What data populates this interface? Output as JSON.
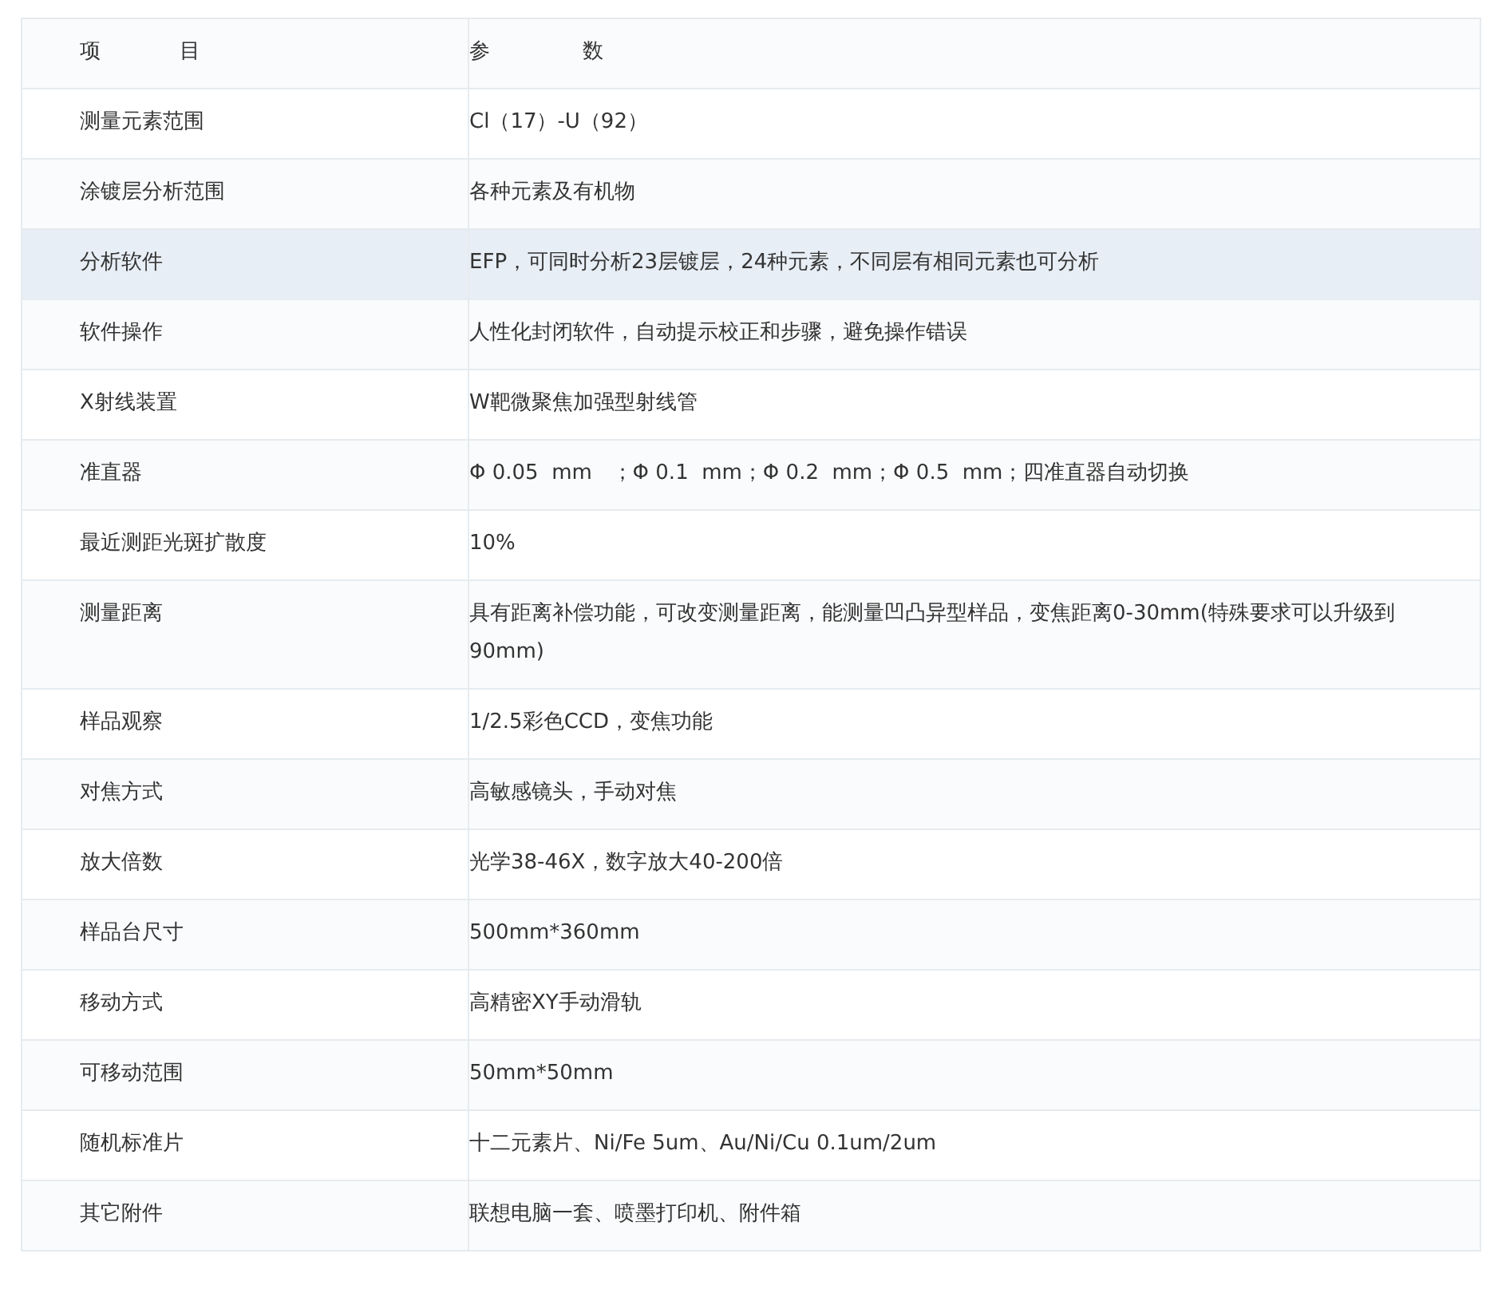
{
  "table": {
    "columns": [
      "项            目",
      "参              数"
    ],
    "rows": [
      {
        "item": "测量元素范围",
        "value": "Cl（17）-U（92）",
        "selected": false
      },
      {
        "item": "涂镀层分析范围",
        "value": "各种元素及有机物",
        "selected": false
      },
      {
        "item": "分析软件",
        "value": "EFP，可同时分析23层镀层，24种元素，不同层有相同元素也可分析",
        "selected": true
      },
      {
        "item": "软件操作",
        "value": "人性化封闭软件，自动提示校正和步骤，避免操作错误",
        "selected": false
      },
      {
        "item": "X射线装置",
        "value": "W靶微聚焦加强型射线管",
        "selected": false
      },
      {
        "item": "准直器",
        "value": "Φ 0.05  mm   ；Φ 0.1  mm；Φ 0.2  mm；Φ 0.5  mm；四准直器自动切换",
        "selected": false
      },
      {
        "item": "最近测距光斑扩散度",
        "value": "10%",
        "selected": false
      },
      {
        "item": "测量距离",
        "value": "具有距离补偿功能，可改变测量距离，能测量凹凸异型样品，变焦距离0-30mm(特殊要求可以升级到90mm)",
        "selected": false
      },
      {
        "item": "样品观察",
        "value": "1/2.5彩色CCD，变焦功能",
        "selected": false
      },
      {
        "item": "对焦方式",
        "value": "高敏感镜头，手动对焦",
        "selected": false
      },
      {
        "item": "放大倍数",
        "value": "光学38-46X，数字放大40-200倍",
        "selected": false
      },
      {
        "item": "样品台尺寸",
        "value": "500mm*360mm",
        "selected": false
      },
      {
        "item": "移动方式",
        "value": "高精密XY手动滑轨",
        "selected": false
      },
      {
        "item": "可移动范围",
        "value": "50mm*50mm",
        "selected": false
      },
      {
        "item": "随机标准片",
        "value": "十二元素片、Ni/Fe 5um、Au/Ni/Cu 0.1um/2um",
        "selected": false
      },
      {
        "item": "其它附件",
        "value": "联想电脑一套、喷墨打印机、附件箱",
        "selected": false
      }
    ]
  }
}
